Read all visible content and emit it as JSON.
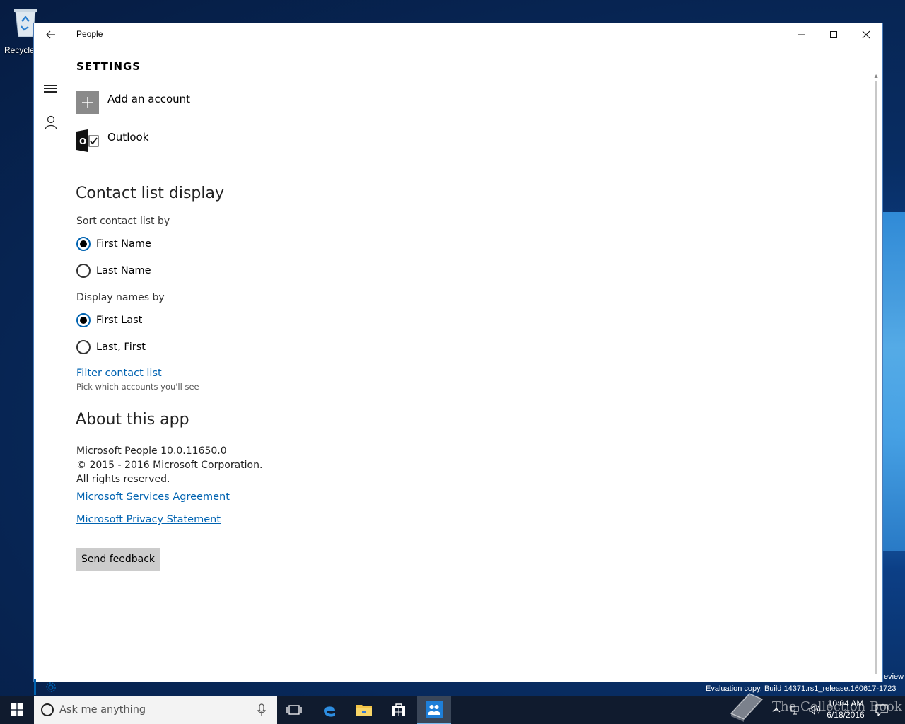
{
  "desktop": {
    "recycle_label": "Recycle",
    "eval_text": "Evaluation copy. Build 14371.rs1_release.160617-1723",
    "eval_partial": "eview",
    "watermark": "The Collection Book"
  },
  "window": {
    "title": "People",
    "page_title": "SETTINGS",
    "accounts": [
      {
        "label": "Add an account",
        "icon": "plus-icon"
      },
      {
        "label": "Outlook",
        "icon": "outlook-icon"
      }
    ],
    "contact_section": {
      "heading": "Contact list display",
      "sort_label": "Sort contact list by",
      "sort_options": [
        {
          "label": "First Name",
          "selected": true
        },
        {
          "label": "Last Name",
          "selected": false
        }
      ],
      "display_label": "Display names by",
      "display_options": [
        {
          "label": "First Last",
          "selected": true
        },
        {
          "label": "Last, First",
          "selected": false
        }
      ],
      "filter_link": "Filter contact list",
      "filter_note": "Pick which accounts you'll see"
    },
    "about_section": {
      "heading": "About this app",
      "version": "Microsoft People 10.0.11650.0",
      "copyright": "© 2015 - 2016 Microsoft Corporation.",
      "rights": "All rights reserved.",
      "services_link": "Microsoft Services Agreement",
      "privacy_link": "Microsoft Privacy Statement",
      "feedback_button": "Send feedback"
    }
  },
  "taskbar": {
    "search_placeholder": "Ask me anything",
    "time": "10:04 AM",
    "date": "6/18/2016"
  },
  "colors": {
    "accent": "#0063b1",
    "taskbar": "#101b2e"
  }
}
